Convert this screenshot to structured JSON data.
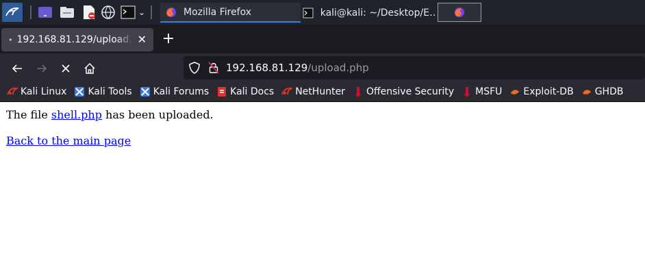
{
  "taskbar": {
    "tasks": [
      {
        "label": "Mozilla Firefox"
      },
      {
        "label": "kali@kali: ~/Desktop/E…"
      }
    ]
  },
  "browser": {
    "tab": {
      "title": "192.168.81.129/upload.php"
    },
    "url": {
      "host": "192.168.81.129",
      "path": "/upload.php"
    },
    "bookmarks": [
      {
        "label": "Kali Linux",
        "icon": "kali-dragon-icon"
      },
      {
        "label": "Kali Tools",
        "icon": "kali-tools-icon"
      },
      {
        "label": "Kali Forums",
        "icon": "kali-forums-icon"
      },
      {
        "label": "Kali Docs",
        "icon": "kali-docs-icon"
      },
      {
        "label": "NetHunter",
        "icon": "nethunter-icon"
      },
      {
        "label": "Offensive Security",
        "icon": "offsec-icon"
      },
      {
        "label": "MSFU",
        "icon": "msfu-icon"
      },
      {
        "label": "Exploit-DB",
        "icon": "exploit-db-icon"
      },
      {
        "label": "GHDB",
        "icon": "ghdb-icon"
      }
    ]
  },
  "page": {
    "message_prefix": "The file ",
    "file_link": "shell.php",
    "message_suffix": " has been uploaded.",
    "back_link": "Back to the main page"
  },
  "colors": {
    "taskbar_bg": "#1f232b",
    "browser_chrome": "#2b2a33",
    "link": "#0000ee",
    "taskbar_accent": "#3c7ee0"
  }
}
